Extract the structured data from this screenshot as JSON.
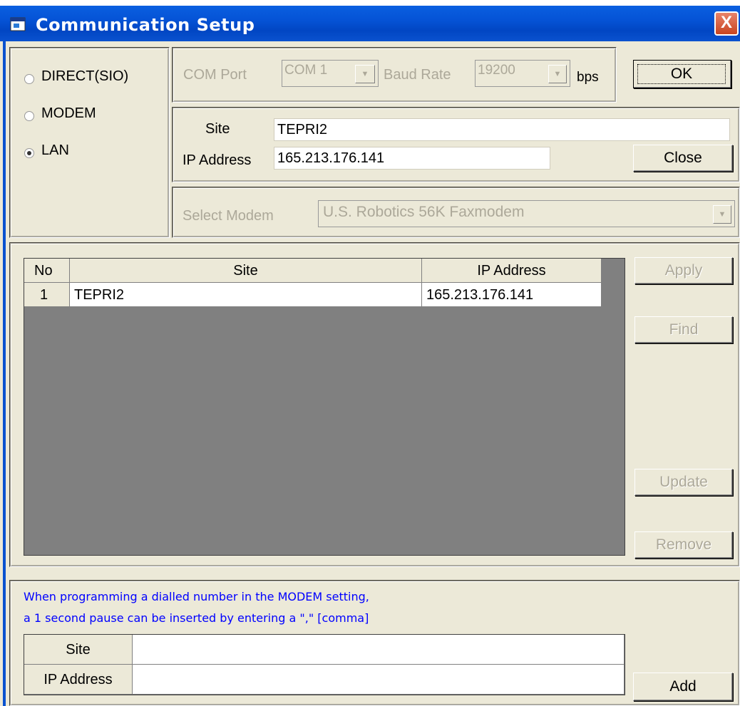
{
  "window": {
    "title": "Communication Setup",
    "close_glyph": "X"
  },
  "connection": {
    "options": [
      {
        "label": "DIRECT(SIO)",
        "selected": false
      },
      {
        "label": "MODEM",
        "selected": false
      },
      {
        "label": "LAN",
        "selected": true
      }
    ]
  },
  "serial": {
    "com_port_label": "COM Port",
    "com_port_value": "COM 1",
    "baud_rate_label": "Baud Rate",
    "baud_rate_value": "19200",
    "bps_label": "bps"
  },
  "lan": {
    "site_label": "Site",
    "site_value": "TEPRI2",
    "ip_label": "IP Address",
    "ip_value": "165.213.176.141"
  },
  "modem": {
    "select_label": "Select Modem",
    "select_value": "U.S. Robotics 56K Faxmodem"
  },
  "buttons": {
    "ok": "OK",
    "close": "Close",
    "apply": "Apply",
    "find": "Find",
    "update": "Update",
    "remove": "Remove",
    "add": "Add"
  },
  "table": {
    "headers": [
      "No",
      "Site",
      "IP Address"
    ],
    "rows": [
      {
        "no": "1",
        "site": "TEPRI2",
        "ip": "165.213.176.141"
      }
    ]
  },
  "note": {
    "line1": "When programming a dialled number in the MODEM setting,",
    "line2": "a 1 second pause can be inserted by entering a \",\" [comma]"
  },
  "entry": {
    "site_label": "Site",
    "site_value": "",
    "ip_label": "IP Address",
    "ip_value": ""
  }
}
